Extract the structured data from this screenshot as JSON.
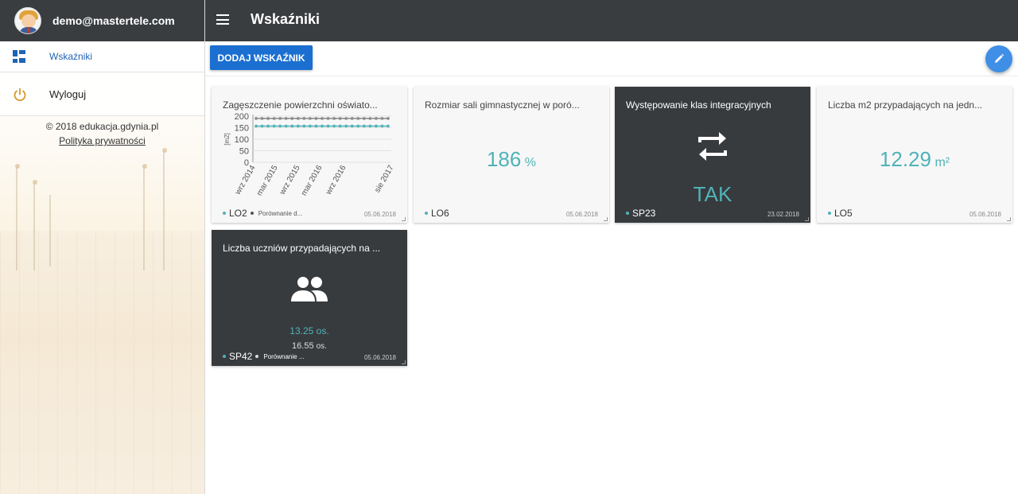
{
  "sidebar": {
    "user_email": "demo@mastertele.com",
    "nav": [
      {
        "label": "Wskaźniki",
        "icon": "dashboard-icon"
      },
      {
        "label": "Wyloguj",
        "icon": "power-icon"
      }
    ],
    "footer_copyright": "© 2018 edukacja.gdynia.pl",
    "footer_link": "Polityka prywatności"
  },
  "header": {
    "title": "Wskaźniki",
    "menu_icon": "hamburger-menu-icon"
  },
  "toolbar": {
    "add_label": "DODAJ WSKAŹNIK",
    "fab_icon": "pencil-icon"
  },
  "colors": {
    "accent": "#4fb3b8",
    "primary": "#1b6fd0",
    "dark_card": "#383b3e",
    "topbar": "#3a3d40"
  },
  "cards": [
    {
      "title": "Zagęszczenie powierzchni oświato...",
      "school": "LO2",
      "compare": "Porównanie d...",
      "date": "05.06.2018",
      "chart_data": {
        "type": "line",
        "ylabel": "[m2]",
        "yticks": [
          "200",
          "150",
          "100",
          "50",
          "0"
        ],
        "ylim": [
          0,
          200
        ],
        "categories": [
          "wrz 2014",
          "mar 2015",
          "wrz 2015",
          "mar 2016",
          "wrz 2016",
          "sie 2017"
        ],
        "series": [
          {
            "color": "#888888",
            "values": [
              190,
              190,
              190,
              190,
              190,
              190,
              190,
              190,
              190,
              190,
              190,
              190,
              190,
              190,
              190,
              190,
              190,
              190,
              190,
              190,
              190,
              190,
              190
            ]
          },
          {
            "color": "#4fb3b8",
            "values": [
              157,
              157,
              157,
              157,
              157,
              157,
              157,
              157,
              157,
              157,
              157,
              157,
              157,
              157,
              157,
              157,
              157,
              157,
              157,
              157,
              157,
              157,
              157
            ]
          }
        ]
      }
    },
    {
      "title": "Rozmiar sali gimnastycznej w poró...",
      "value": "186",
      "unit": "%",
      "school": "LO6",
      "date": "05.06.2018"
    },
    {
      "title": "Występowanie klas integracyjnych",
      "value": "TAK",
      "school": "SP23",
      "date": "23.02.2018",
      "icon": "swap-arrows-icon"
    },
    {
      "title": "Liczba m2 przypadających na jedn...",
      "value": "12.29",
      "unit": "m²",
      "school": "LO5",
      "date": "05.06.2018"
    },
    {
      "title": "Liczba uczniów przypadających na ...",
      "value": "13.25",
      "unit": "os.",
      "value2": "16.55",
      "unit2": "os.",
      "school": "SP42",
      "compare": "Porównanie ...",
      "date": "05.06.2018",
      "icon": "people-icon"
    }
  ]
}
